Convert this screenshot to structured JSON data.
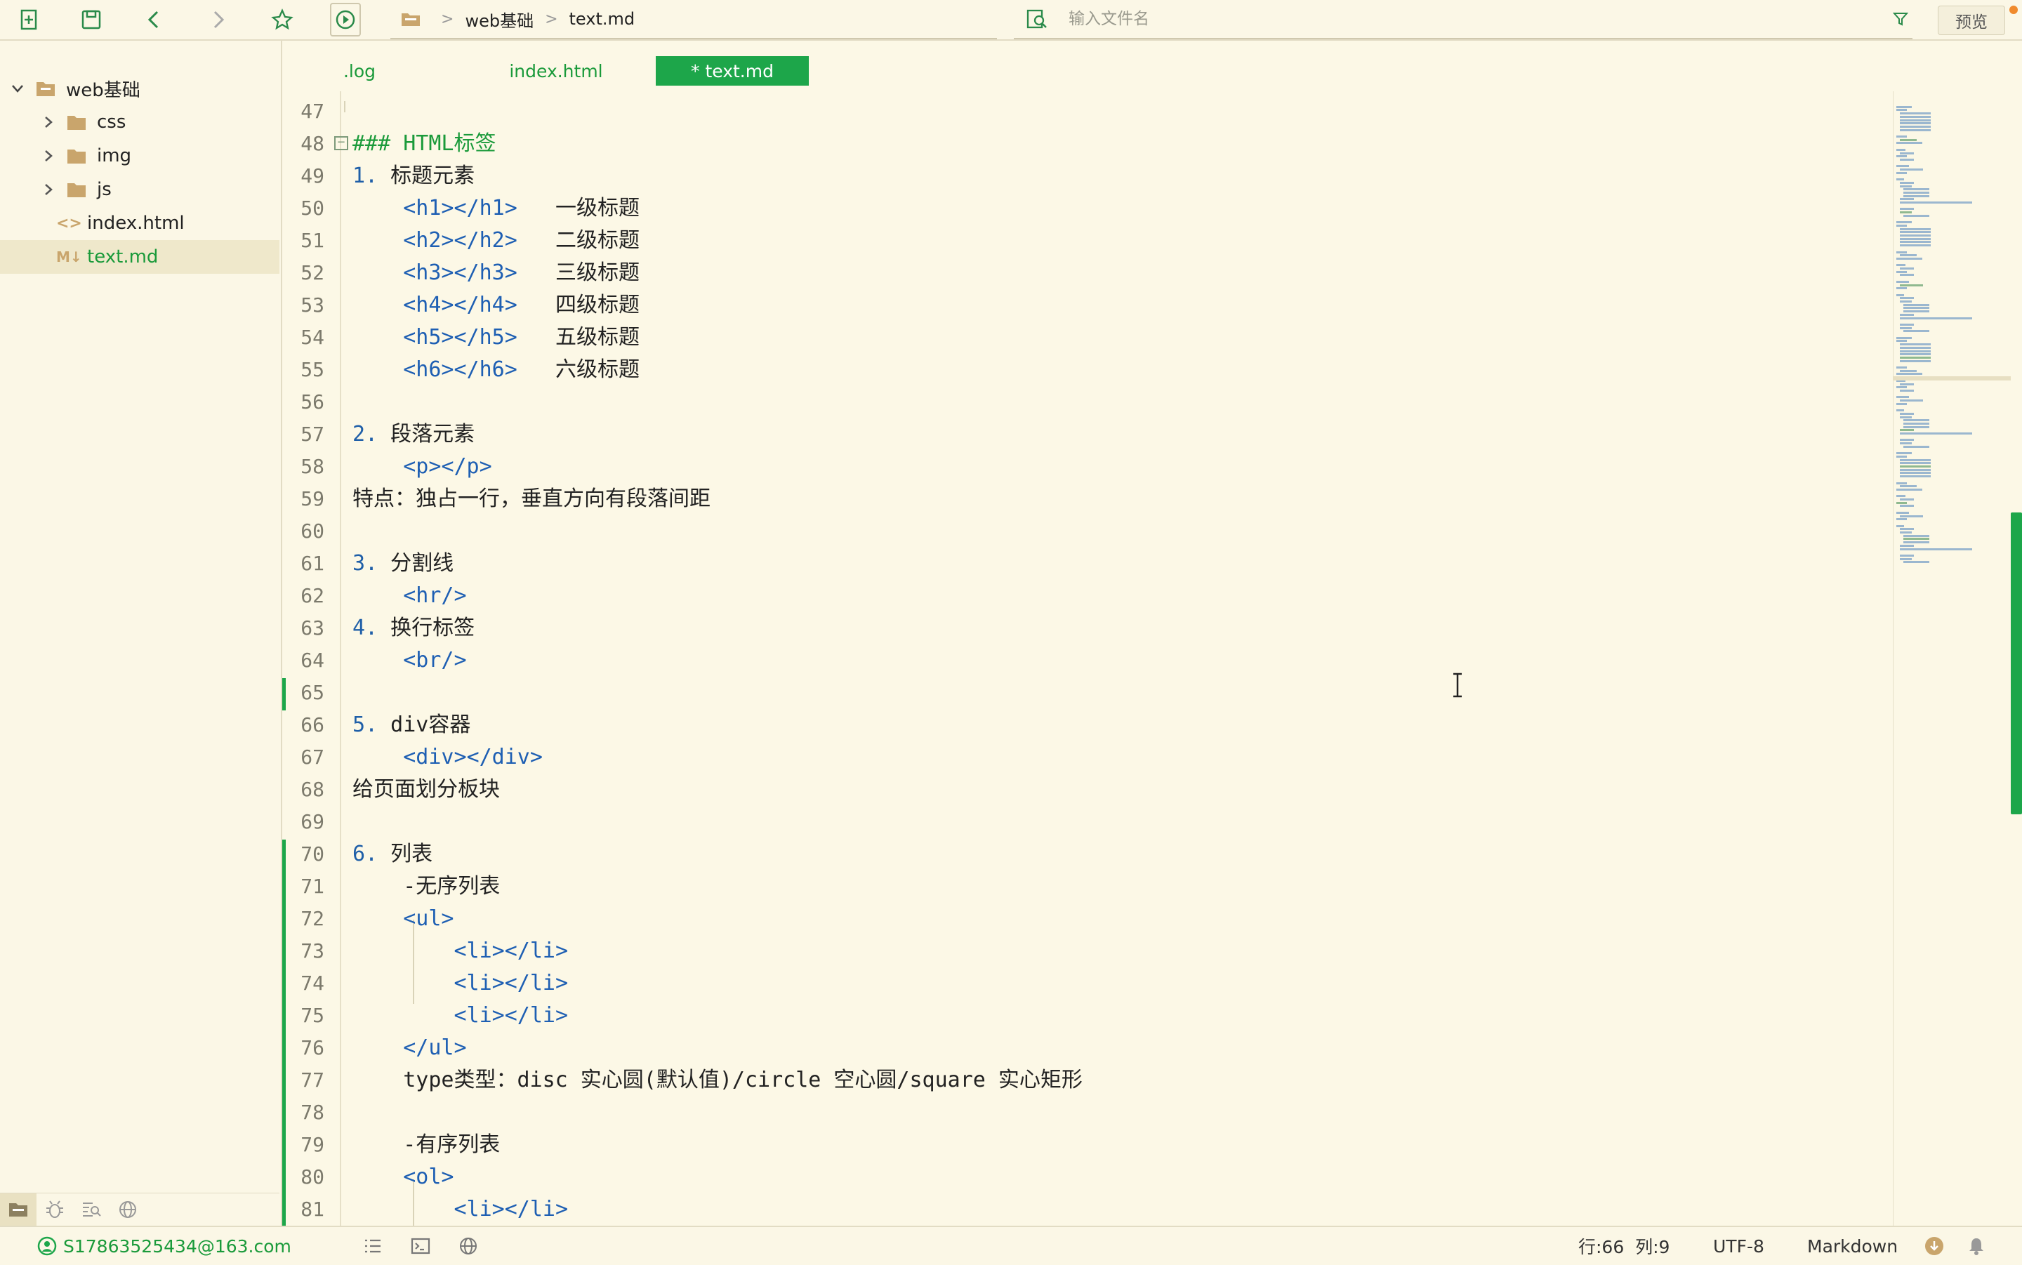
{
  "toolbar": {
    "icons": [
      "new-file-icon",
      "save-icon",
      "back-icon",
      "forward-icon",
      "star-icon",
      "run-icon"
    ],
    "breadcrumb": [
      "web基础",
      "text.md"
    ],
    "search_placeholder": "输入文件名",
    "preview_label": "预览"
  },
  "sidebar": {
    "root": "web基础",
    "items": [
      {
        "label": "css",
        "type": "folder"
      },
      {
        "label": "img",
        "type": "folder"
      },
      {
        "label": "js",
        "type": "folder"
      },
      {
        "label": "index.html",
        "type": "html"
      },
      {
        "label": "text.md",
        "type": "markdown",
        "selected": true
      }
    ],
    "bottom_icons": [
      "folder-icon",
      "bug-icon",
      "search-list-icon",
      "globe-icon"
    ]
  },
  "tabs": [
    {
      "label": ".log"
    },
    {
      "label": "index.html"
    },
    {
      "label": "* text.md",
      "active": true
    }
  ],
  "editor": {
    "lines": [
      {
        "n": "47",
        "text": ""
      },
      {
        "n": "48",
        "text": "### HTML标签"
      },
      {
        "n": "49",
        "text": "1. 标题元素"
      },
      {
        "n": "50",
        "text": "    <h1></h1>   一级标题"
      },
      {
        "n": "51",
        "text": "    <h2></h2>   二级标题"
      },
      {
        "n": "52",
        "text": "    <h3></h3>   三级标题"
      },
      {
        "n": "53",
        "text": "    <h4></h4>   四级标题"
      },
      {
        "n": "54",
        "text": "    <h5></h5>   五级标题"
      },
      {
        "n": "55",
        "text": "    <h6></h6>   六级标题"
      },
      {
        "n": "56",
        "text": ""
      },
      {
        "n": "57",
        "text": "2. 段落元素"
      },
      {
        "n": "58",
        "text": "    <p></p>"
      },
      {
        "n": "59",
        "text": "特点：独占一行，垂直方向有段落间距"
      },
      {
        "n": "60",
        "text": ""
      },
      {
        "n": "61",
        "text": "3. 分割线"
      },
      {
        "n": "62",
        "text": "    <hr/>"
      },
      {
        "n": "63",
        "text": "4. 换行标签"
      },
      {
        "n": "64",
        "text": "    <br/>"
      },
      {
        "n": "65",
        "text": ""
      },
      {
        "n": "66",
        "text": "5. div容器"
      },
      {
        "n": "67",
        "text": "    <div></div>"
      },
      {
        "n": "68",
        "text": "给页面划分板块"
      },
      {
        "n": "69",
        "text": ""
      },
      {
        "n": "70",
        "text": "6. 列表"
      },
      {
        "n": "71",
        "text": "    -无序列表"
      },
      {
        "n": "72",
        "text": "    <ul>"
      },
      {
        "n": "73",
        "text": "        <li></li>"
      },
      {
        "n": "74",
        "text": "        <li></li>"
      },
      {
        "n": "75",
        "text": "        <li></li>"
      },
      {
        "n": "76",
        "text": "    </ul>"
      },
      {
        "n": "77",
        "text": "    type类型：disc 实心圆(默认值)/circle 空心圆/square 实心矩形"
      },
      {
        "n": "78",
        "text": ""
      },
      {
        "n": "79",
        "text": "    -有序列表"
      },
      {
        "n": "80",
        "text": "    <ol>"
      },
      {
        "n": "81",
        "text": "        <li></li>"
      }
    ]
  },
  "status": {
    "user": "S17863525434@163.com",
    "position": "行:66  列:9",
    "encoding": "UTF-8",
    "language": "Markdown"
  },
  "colors": {
    "accent": "#1da64a",
    "background": "#fcf8e6",
    "tag": "#1e5fb3",
    "header": "#1a9a3a"
  }
}
